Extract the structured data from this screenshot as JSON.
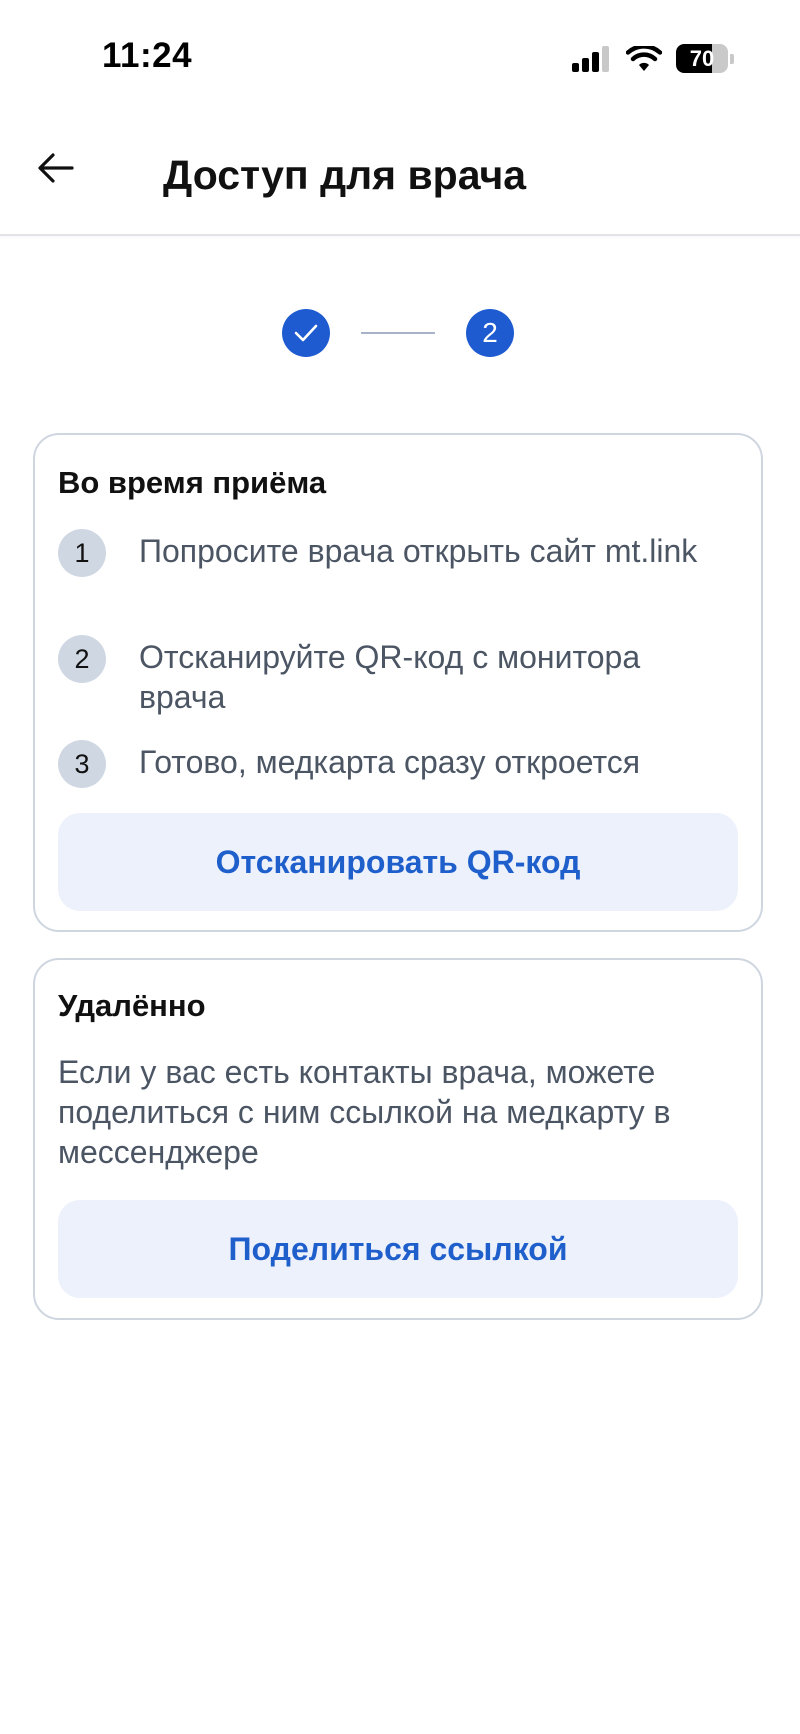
{
  "status_bar": {
    "time": "11:24",
    "battery_level": "70",
    "battery_fraction": 0.7,
    "icons": [
      "signal-icon",
      "wifi-icon",
      "battery-icon"
    ]
  },
  "header": {
    "title": "Доступ для врача",
    "back_icon": "arrow-left-icon"
  },
  "stepper": {
    "step1_icon": "checkmark-icon",
    "step2_label": "2",
    "active_color": "#1e5bd1",
    "current_step": 2,
    "total_steps": 2
  },
  "in_person": {
    "title": "Во время приёма",
    "steps": [
      {
        "number": "1",
        "text": "Попросите врача открыть сайт mt.link"
      },
      {
        "number": "2",
        "text": "Отсканируйте QR-код с монитора врача"
      },
      {
        "number": "3",
        "text": "Готово, медкарта сразу откроется"
      }
    ],
    "button_label": "Отсканировать QR-код"
  },
  "remote": {
    "title": "Удалённо",
    "text": "Если у вас есть контакты врача, можете поделиться с ним ссылкой на медкарту в мессенджере",
    "button_label": "Поделиться ссылкой"
  },
  "colors": {
    "accent": "#1f5fcc",
    "button_bg": "#edf1fb",
    "badge_bg": "#cfd7e3",
    "border": "#cfd6e0"
  }
}
